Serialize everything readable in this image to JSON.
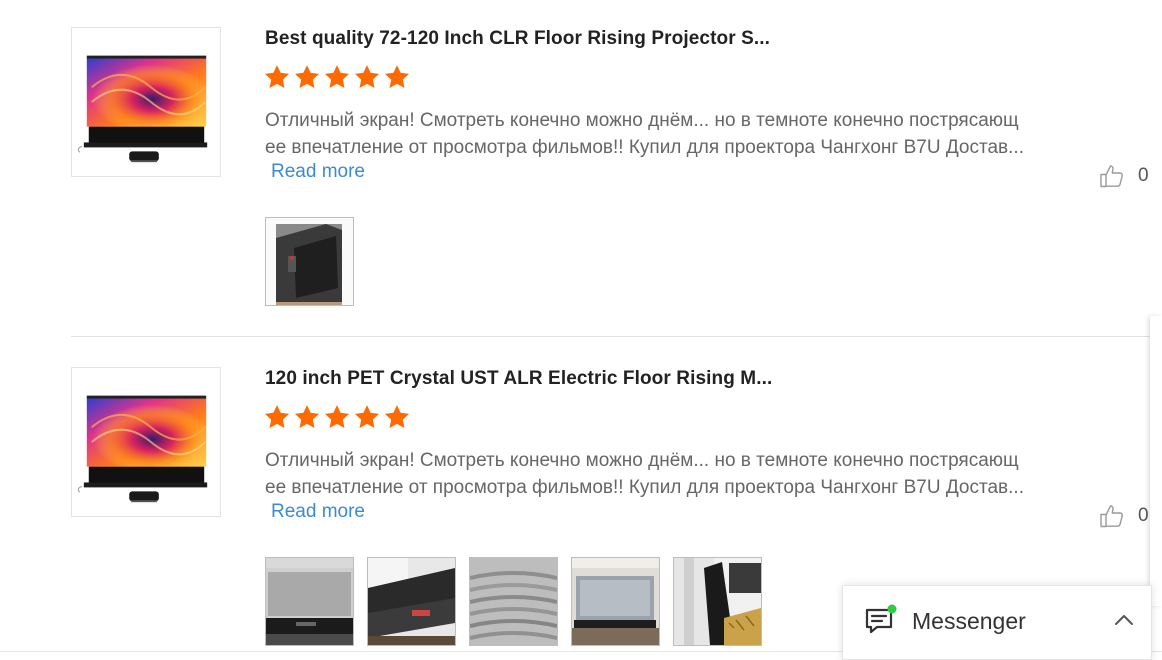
{
  "reviews": [
    {
      "title": "Best quality 72-120 Inch CLR Floor Rising Projector S...",
      "rating": 5,
      "text_line_1": "Отличный экран! Смотреть конечно можно днём... но в темноте конечно пострясающ",
      "text_line_2": "ее впечатление от просмотра фильмов!! Купил для проектора Чангхонг B7U Достав...",
      "read_more": "Read more",
      "likes": "0",
      "photo_count": 1
    },
    {
      "title": "120 inch PET Crystal UST ALR Electric Floor Rising M...",
      "rating": 5,
      "text_line_1": "Отличный экран! Смотреть конечно можно днём... но в темноте конечно пострясающ",
      "text_line_2": "ее впечатление от просмотра фильмов!! Купил для проектора Чангхонг B7U Достав...",
      "read_more": "Read more",
      "likes": "0",
      "photo_count": 5
    }
  ],
  "messenger": {
    "label": "Messenger",
    "icon": "chat-icon",
    "status_color": "#2ecc40"
  },
  "colors": {
    "star": "#ff6a00",
    "link": "#3a8bd1"
  }
}
